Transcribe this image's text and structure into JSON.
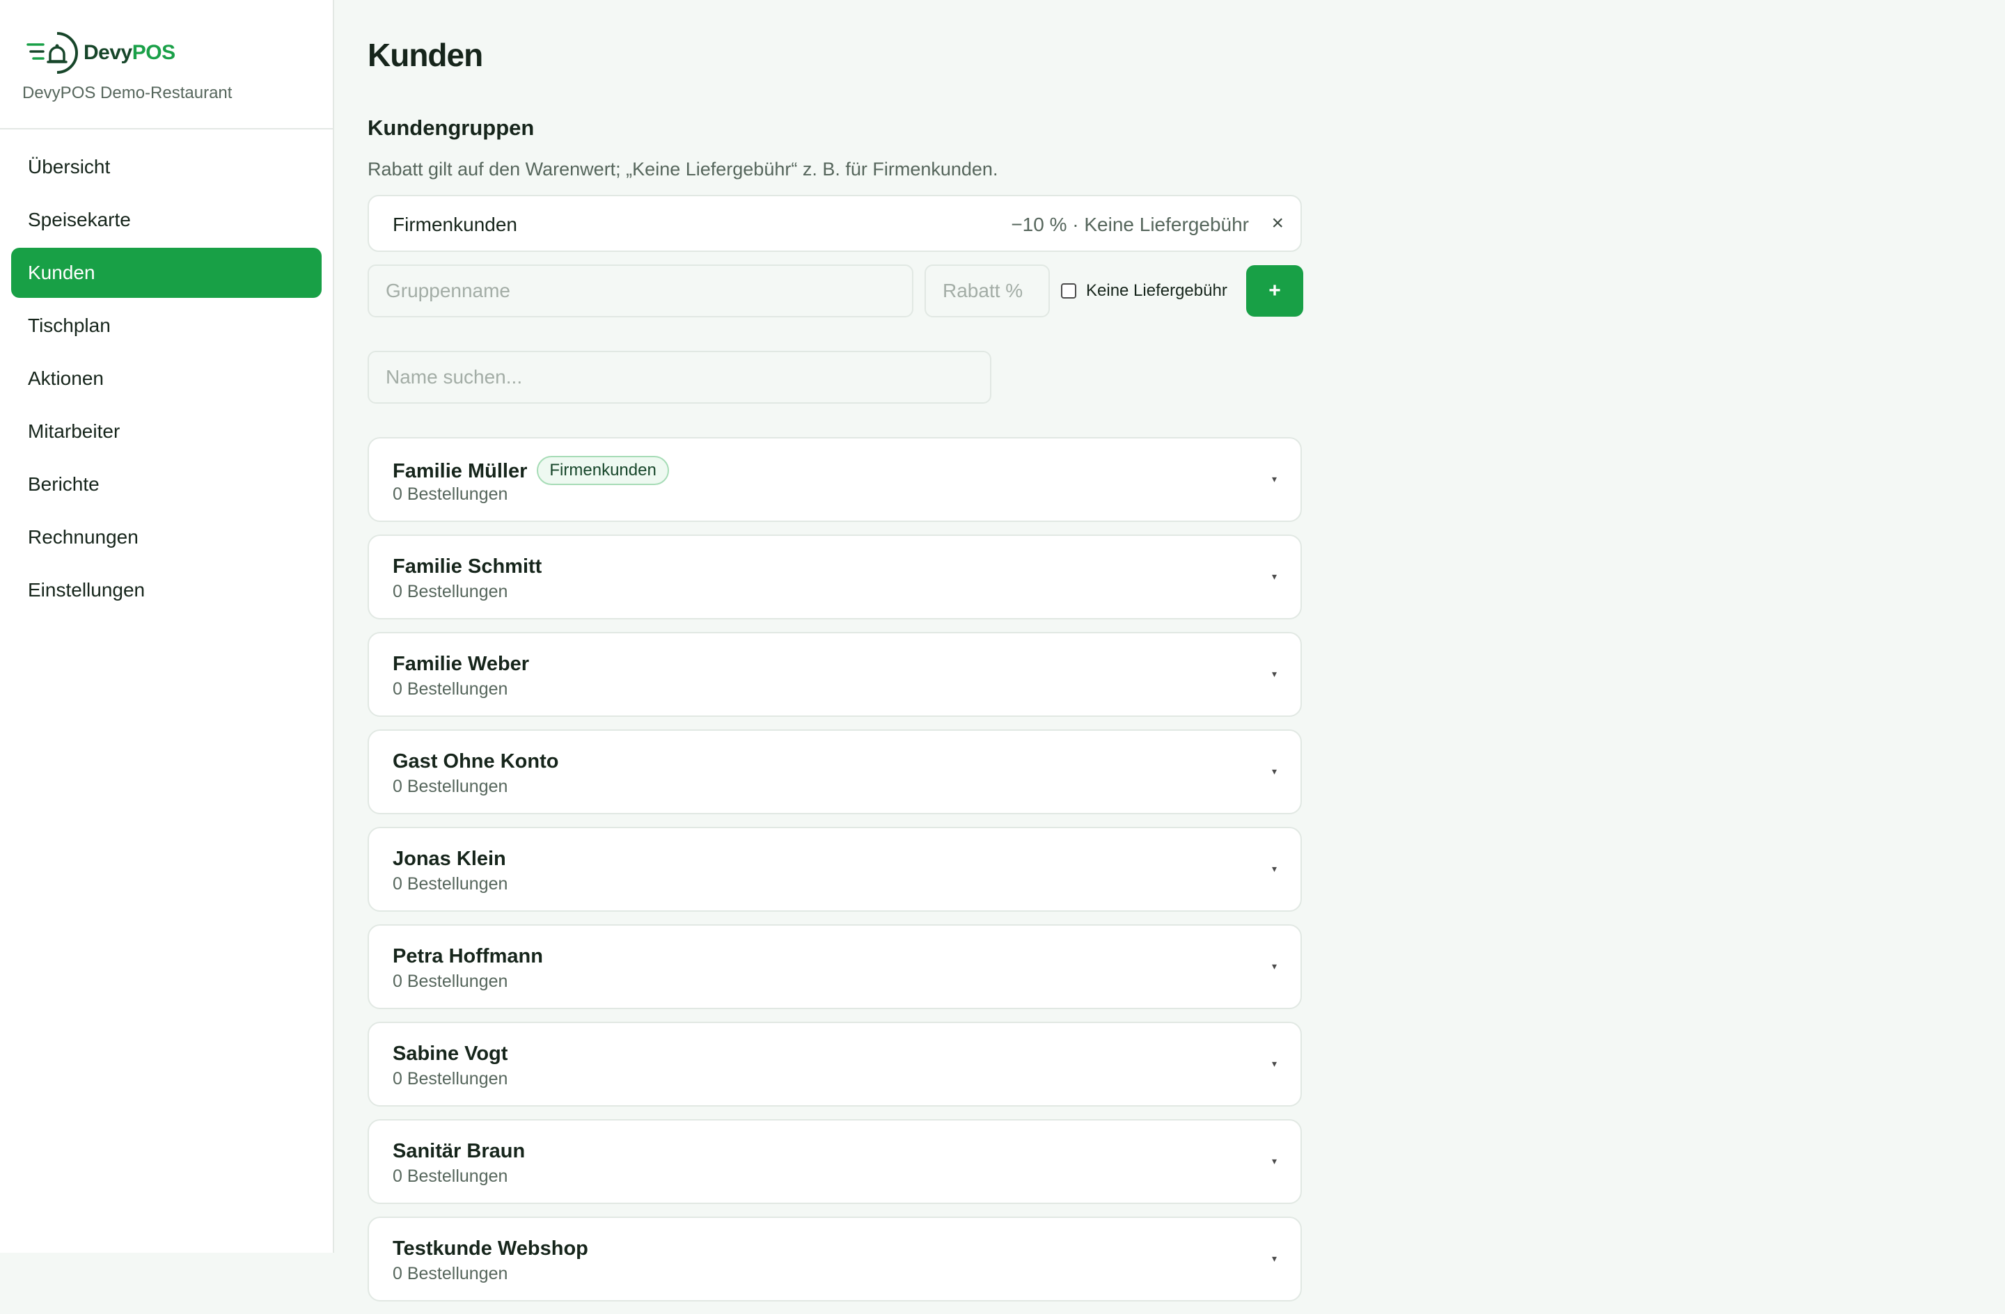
{
  "brand": {
    "logo_text_a": "Devy",
    "logo_text_b": "POS",
    "restaurant": "DevyPOS Demo-Restaurant",
    "colors": {
      "primary": "#18a046",
      "dark": "#17462a"
    }
  },
  "nav": {
    "items": [
      {
        "label": "Übersicht",
        "active": false
      },
      {
        "label": "Speisekarte",
        "active": false
      },
      {
        "label": "Kunden",
        "active": true
      },
      {
        "label": "Tischplan",
        "active": false
      },
      {
        "label": "Aktionen",
        "active": false
      },
      {
        "label": "Mitarbeiter",
        "active": false
      },
      {
        "label": "Berichte",
        "active": false
      },
      {
        "label": "Rechnungen",
        "active": false
      },
      {
        "label": "Einstellungen",
        "active": false
      }
    ]
  },
  "page": {
    "title": "Kunden",
    "groups_title": "Kundengruppen",
    "groups_desc": "Rabatt gilt auf den Warenwert; „Keine Liefergebühr“ z. B. für Firmenkunden."
  },
  "groups": [
    {
      "name": "Firmenkunden",
      "meta": "−10 % · Keine Liefergebühr",
      "remove_icon": "×"
    }
  ],
  "new_group": {
    "name_placeholder": "Gruppenname",
    "name_value": "",
    "rabatt_placeholder": "Rabatt %",
    "rabatt_value": "",
    "no_fee_label": "Keine Liefergebühr",
    "no_fee_checked": false,
    "add_label": "+"
  },
  "search": {
    "placeholder": "Name suchen...",
    "value": ""
  },
  "customers": [
    {
      "name": "Familie Müller",
      "orders": "0 Bestellungen",
      "badge": "Firmenkunden"
    },
    {
      "name": "Familie Schmitt",
      "orders": "0 Bestellungen"
    },
    {
      "name": "Familie Weber",
      "orders": "0 Bestellungen"
    },
    {
      "name": "Gast Ohne Konto",
      "orders": "0 Bestellungen"
    },
    {
      "name": "Jonas Klein",
      "orders": "0 Bestellungen"
    },
    {
      "name": "Petra Hoffmann",
      "orders": "0 Bestellungen"
    },
    {
      "name": "Sabine Vogt",
      "orders": "0 Bestellungen"
    },
    {
      "name": "Sanitär Braun",
      "orders": "0 Bestellungen"
    },
    {
      "name": "Testkunde Webshop",
      "orders": "0 Bestellungen"
    }
  ],
  "icons": {
    "chevron": "▾",
    "logo": "bell-delivery-icon"
  }
}
